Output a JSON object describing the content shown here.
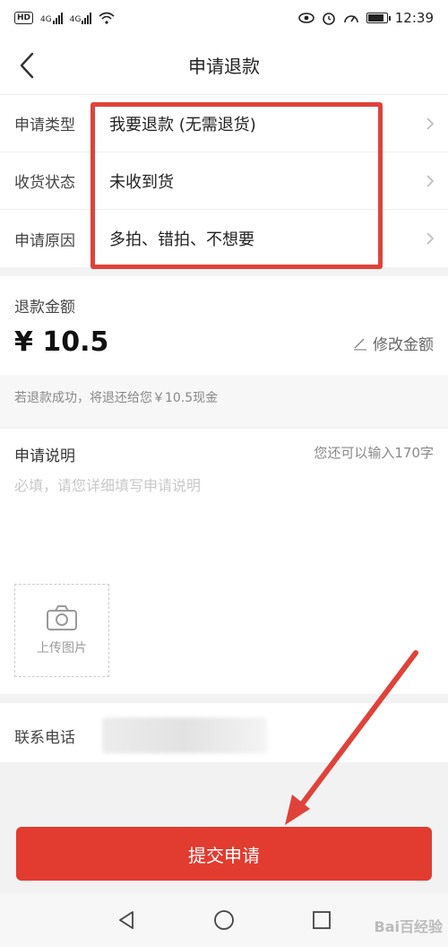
{
  "status_bar": {
    "hd_badge": "HD",
    "network_1": "4G",
    "network_2": "4G",
    "time": "12:39",
    "battery_level": 0.8
  },
  "header": {
    "title": "申请退款"
  },
  "form_rows": [
    {
      "label": "申请类型",
      "value": "我要退款 (无需退货)"
    },
    {
      "label": "收货状态",
      "value": "未收到货"
    },
    {
      "label": "申请原因",
      "value": "多拍、错拍、不想要"
    }
  ],
  "refund": {
    "label": "退款金额",
    "amount": "¥ 10.5",
    "modify_label": "修改金额",
    "note": "若退款成功，将退还给您￥10.5现金"
  },
  "description": {
    "label": "申请说明",
    "counter": "您还可以输入170字",
    "placeholder": "必填，请您详细填写申请说明",
    "value": ""
  },
  "upload": {
    "label": "上传图片"
  },
  "contact": {
    "label": "联系电话"
  },
  "submit": {
    "label": "提交申请"
  },
  "watermark": "Bai百经验",
  "colors": {
    "accent": "#e23b30",
    "highlight": "#e0423a"
  },
  "icons": [
    "back-arrow-icon",
    "chevron-right-icon",
    "edit-pencil-icon",
    "camera-icon",
    "nav-back-icon",
    "nav-home-icon",
    "nav-recent-icon"
  ]
}
